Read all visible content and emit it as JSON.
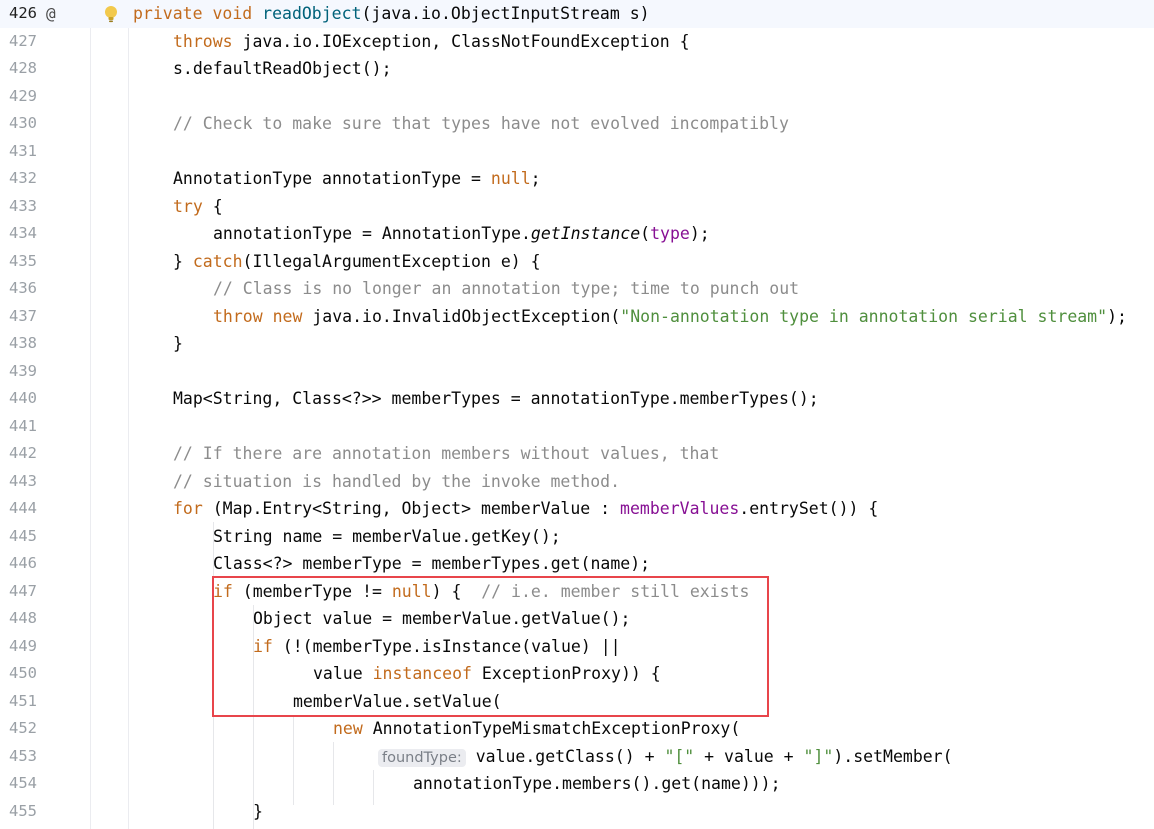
{
  "editor": {
    "colors": {
      "keyword": "#c26b1d",
      "comment": "#8c8c8c",
      "string": "#4f8f3d",
      "method": "#0033b3",
      "field": "#871094",
      "highlight_box": "#e8454b"
    },
    "gutter_icons": {
      "line_426_override": "@",
      "line_426_intention": "lightbulb-icon"
    },
    "inlay_hint": "foundType:",
    "lines": [
      {
        "n": "426"
      },
      {
        "n": "427"
      },
      {
        "n": "428"
      },
      {
        "n": "429"
      },
      {
        "n": "430"
      },
      {
        "n": "431"
      },
      {
        "n": "432"
      },
      {
        "n": "433"
      },
      {
        "n": "434"
      },
      {
        "n": "435"
      },
      {
        "n": "436"
      },
      {
        "n": "437"
      },
      {
        "n": "438"
      },
      {
        "n": "439"
      },
      {
        "n": "440"
      },
      {
        "n": "441"
      },
      {
        "n": "442"
      },
      {
        "n": "443"
      },
      {
        "n": "444"
      },
      {
        "n": "445"
      },
      {
        "n": "446"
      },
      {
        "n": "447"
      },
      {
        "n": "448"
      },
      {
        "n": "449"
      },
      {
        "n": "450"
      },
      {
        "n": "451"
      },
      {
        "n": "452"
      },
      {
        "n": "453"
      },
      {
        "n": "454"
      },
      {
        "n": "455"
      }
    ],
    "tokens": {
      "l426": [
        "private void ",
        "readObject",
        "(java.io.ObjectInputStream s)"
      ],
      "l427": [
        "throws",
        " java.io.IOException, ClassNotFoundException {"
      ],
      "l428": [
        "s.defaultReadObject();"
      ],
      "l430": [
        "// Check to make sure that types have not evolved incompatibly"
      ],
      "l432": [
        "AnnotationType annotationType = ",
        "null",
        ";"
      ],
      "l433": [
        "try",
        " {"
      ],
      "l434": [
        "annotationType = AnnotationType.",
        "getInstance",
        "(",
        "type",
        ");"
      ],
      "l435": [
        "} ",
        "catch",
        "(IllegalArgumentException e) {"
      ],
      "l436": [
        "// Class is no longer an annotation type; time to punch out"
      ],
      "l437": [
        "throw new",
        " java.io.InvalidObjectException(",
        "\"Non-annotation type in annotation serial stream\"",
        ");"
      ],
      "l438": [
        "}"
      ],
      "l440": [
        "Map<String, Class<?>> memberTypes = annotationType.memberTypes();"
      ],
      "l442": [
        "// If there are annotation members without values, that"
      ],
      "l443": [
        "// situation is handled by the invoke method."
      ],
      "l444": [
        "for",
        " (Map.Entry<String, Object> memberValue : ",
        "memberValues",
        ".entrySet()) {"
      ],
      "l445": [
        "String name = memberValue.getKey();"
      ],
      "l446": [
        "Class<?> memberType = memberTypes.get(name);"
      ],
      "l447": [
        "if",
        " (memberType != ",
        "null",
        ") {  ",
        "// i.e. member still exists"
      ],
      "l448": [
        "Object value = memberValue.getValue();"
      ],
      "l449": [
        "if",
        " (!(memberType.isInstance(value) ||"
      ],
      "l450": [
        "value ",
        "instanceof",
        " ExceptionProxy)) {"
      ],
      "l451": [
        "memberValue.setValue("
      ],
      "l452": [
        "new",
        " AnnotationTypeMismatchExceptionProxy("
      ],
      "l453": [
        "value.getClass() + ",
        "\"[\"",
        " + value + ",
        "\"]\"",
        ").setMember("
      ],
      "l454": [
        "annotationType.members().get(name)));"
      ],
      "l455": [
        "}"
      ]
    }
  }
}
